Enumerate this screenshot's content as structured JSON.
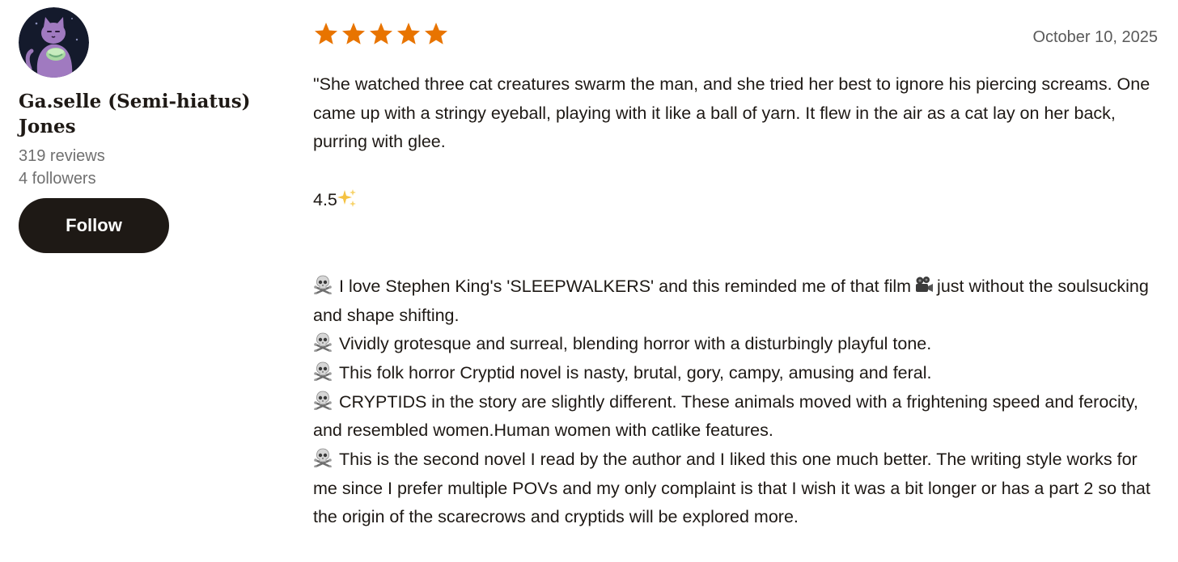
{
  "reviewer": {
    "avatar_icon": "purple-cat-avatar-icon",
    "name_line1": "Ga.selle (Semi-hiatus)",
    "name_line2": "Jones",
    "reviews_count": "319 reviews",
    "followers_count": "4 followers",
    "follow_label": "Follow"
  },
  "review": {
    "rating": 5,
    "rating_max": 5,
    "star_color": "#e87400",
    "date": "October 10, 2025",
    "quote": "\"She watched three cat creatures swarm the man, and she tried her best to ignore his piercing screams. One came up with a stringy eyeball, playing with it like a ball of yarn. It flew in the air as a cat lay on her back, purring with glee.",
    "score_text": "4.5",
    "score_icon": "sparkles-icon",
    "bullet_icon": "skull-crossbones-icon",
    "bullets": [
      {
        "before": "I love Stephen King's 'SLEEPWALKERS' and this reminded me of that film",
        "inline_icon": "movie-camera-icon",
        "after": "just without the soulsucking and shape shifting."
      },
      {
        "text": "Vividly grotesque and surreal, blending horror with a disturbingly playful tone."
      },
      {
        "text": "This folk horror Cryptid novel is nasty, brutal, gory, campy, amusing and feral."
      },
      {
        "text": "CRYPTIDS in the story are slightly different. These animals moved with a frightening speed and ferocity, and resembled women.Human women with catlike features."
      },
      {
        "text": "This is the second novel I read by the author and I liked this one much better. The writing style works for me since I prefer multiple POVs and my only complaint is that I wish it was a bit longer or has a part 2 so that the origin of the scarecrows and cryptids will be explored more."
      }
    ]
  }
}
